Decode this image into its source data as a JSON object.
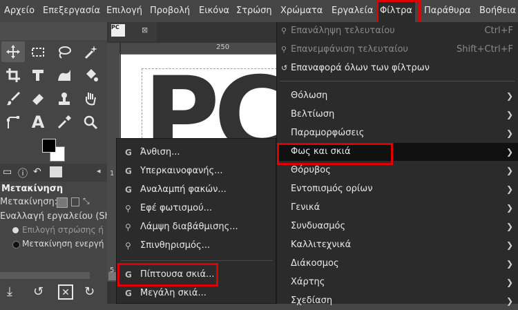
{
  "menubar": {
    "items": [
      "Αρχείο",
      "Επεξεργασία",
      "Επιλογή",
      "Προβολή",
      "Εικόνα",
      "Στρώση",
      "Χρώματα",
      "Εργαλεία",
      "Φίλτρα",
      "Παράθυρα",
      "Βοήθεια"
    ],
    "active": "Φίλτρα"
  },
  "toolbox": {
    "tools": [
      "move-tool",
      "rect-select-tool",
      "lasso-tool",
      "fuzzy-select-tool",
      "crop-tool",
      "text-transform-tool",
      "warp-tool",
      "bucket-fill-tool",
      "paintbrush-tool",
      "eraser-tool",
      "clone-tool",
      "smudge-tool",
      "paths-tool",
      "text-tool",
      "color-picker-tool",
      "zoom-tool"
    ],
    "text_tool_glyph": "A",
    "tool_options": {
      "title": "Μετακίνηση",
      "move_label": "Μετακίνηση:",
      "toggle_label": "Εναλλαγή εργαλείου  (Shi",
      "radio1": "Επιλογή στρώσης ή",
      "radio2": "Μετακίνηση ενεργή"
    }
  },
  "canvas": {
    "tab_label": "PC",
    "ruler_label": "250",
    "ruler_v_label1": "1",
    "ruler_v_label2": "5",
    "big_text": "PC"
  },
  "light_shadow_submenu": {
    "items": [
      {
        "icon": "G",
        "label": "Άνθιση..."
      },
      {
        "icon": "G",
        "label": "Υπερκαινοφανής..."
      },
      {
        "icon": "G",
        "label": "Αναλαμπή φακών..."
      },
      {
        "icon": "⚲",
        "label": "Εφέ φωτισμού..."
      },
      {
        "icon": "⚲",
        "label": "Λάμψη διαβάθμισης..."
      },
      {
        "icon": "⚲",
        "label": "Σπινθηρισμός..."
      },
      {
        "icon": "G",
        "label": "Πίπτουσα σκιά..."
      },
      {
        "icon": "G",
        "label": "Μεγάλη σκιά..."
      }
    ]
  },
  "filters_menu": {
    "top": [
      {
        "icon": "⚲",
        "label": "Επανάληψη τελευταίου",
        "accel": "Ctrl+F"
      },
      {
        "icon": "⚲",
        "label": "Επανεμφάνιση τελευταίου",
        "accel": "Shift+Ctrl+F"
      },
      {
        "icon": "↺",
        "label": "Επαναφορά όλων των φίλτρων",
        "accel": ""
      }
    ],
    "groups": [
      "Θόλωση",
      "Βελτίωση",
      "Παραμορφώσεις",
      "Φως και σκιά",
      "Θόρυβος",
      "Εντοπισμός ορίων",
      "Γενικά",
      "Συνδυασμός",
      "Καλλιτεχνικά",
      "Διάκοσμος",
      "Χάρτης",
      "Σχεδίαση"
    ],
    "highlighted": "Φως και σκιά"
  },
  "colors": {
    "menu_bg": "#2b2b2b",
    "highlight_bg": "#111111",
    "annotation_red": "#e00000"
  }
}
